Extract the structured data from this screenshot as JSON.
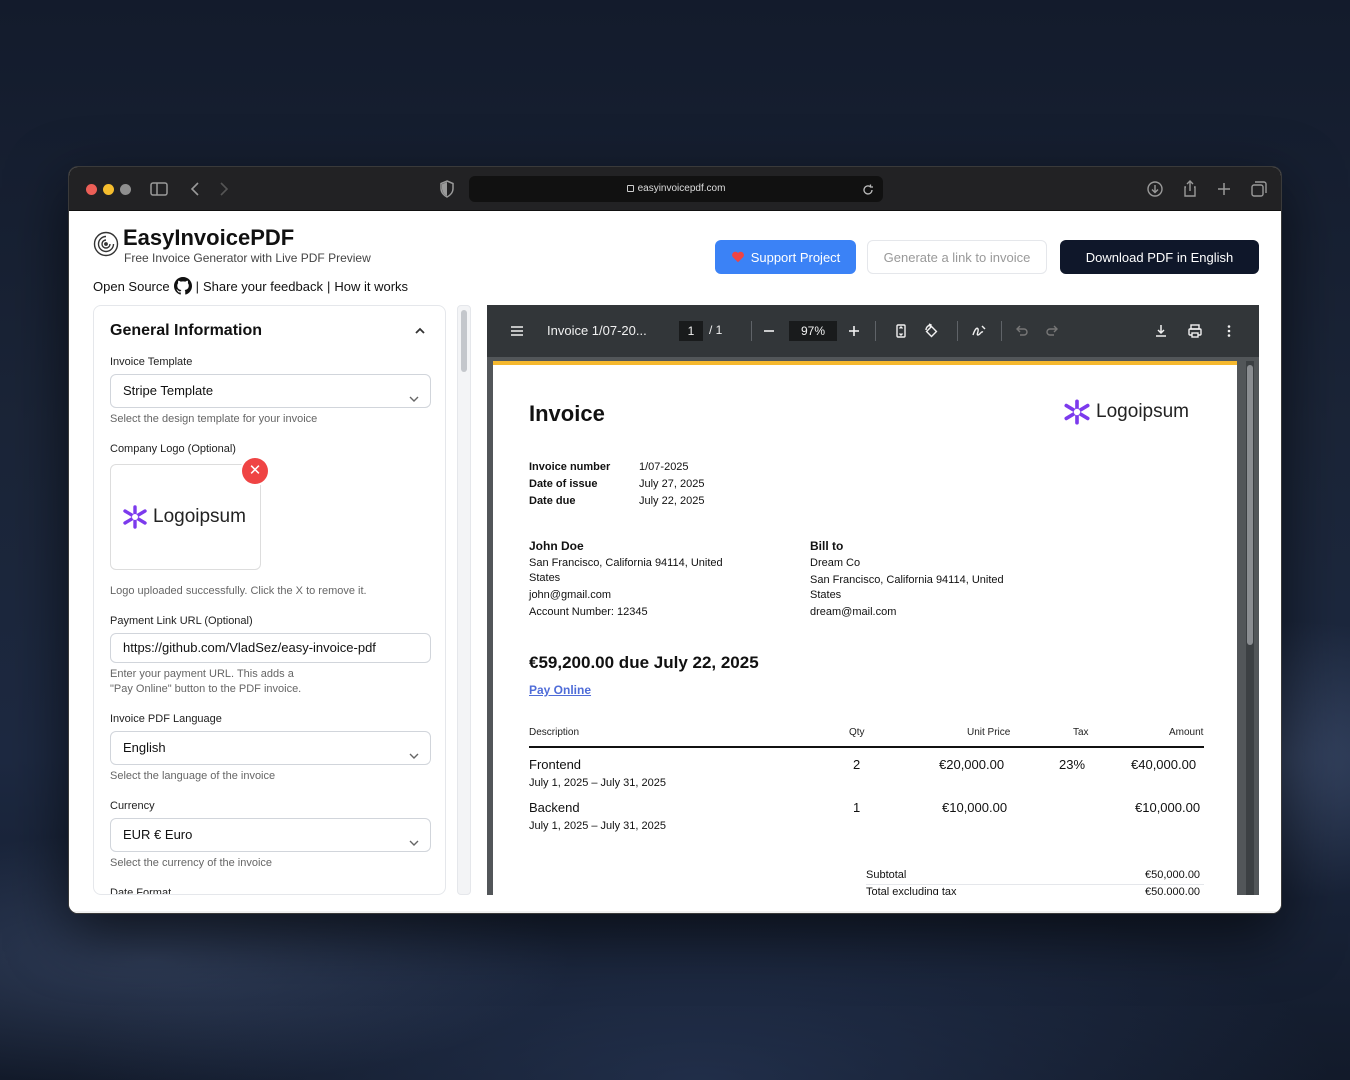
{
  "browser": {
    "url": "easyinvoicepdf.com",
    "traffic_lights": [
      "#ec5f57",
      "#f5bd2e",
      "#8f8f8f"
    ]
  },
  "app": {
    "title": "EasyInvoicePDF",
    "tagline": "Free Invoice Generator with Live PDF Preview",
    "links": {
      "open_source": "Open Source",
      "sep1": "|",
      "feedback": "Share your feedback",
      "sep2": "|",
      "how": "How it works"
    },
    "buttons": {
      "support": "Support Project",
      "support_icon": "heart-icon",
      "generate_link": "Generate a link to invoice",
      "download": "Download PDF in English"
    }
  },
  "form": {
    "section_title": "General Information",
    "template_label": "Invoice Template",
    "template_value": "Stripe Template",
    "template_hint": "Select the design template for your invoice",
    "logo_label": "Company Logo (Optional)",
    "logo_text": "Logoipsum",
    "logo_hint": "Logo uploaded successfully. Click the X to remove it.",
    "payment_label": "Payment Link URL (Optional)",
    "payment_value": "https://github.com/VladSez/easy-invoice-pdf",
    "payment_hint_1": "Enter your payment URL. This adds a",
    "payment_hint_2": "\"Pay Online\" button to the PDF invoice.",
    "language_label": "Invoice PDF Language",
    "language_value": "English",
    "language_hint": "Select the language of the invoice",
    "currency_label": "Currency",
    "currency_value": "EUR € Euro",
    "currency_hint": "Select the currency of the invoice",
    "next_label_partial": "Date Format"
  },
  "viewer": {
    "doc_title": "Invoice 1/07-20...",
    "page_current": "1",
    "page_total": "/   1",
    "zoom": "97%"
  },
  "invoice": {
    "heading": "Invoice",
    "logo_text": "Logoipsum",
    "meta": [
      {
        "label": "Invoice number",
        "value": "1/07-2025"
      },
      {
        "label": "Date of issue",
        "value": "July 27, 2025"
      },
      {
        "label": "Date due",
        "value": "July 22, 2025"
      }
    ],
    "seller": {
      "name": "John Doe",
      "address_1": "San Francisco, California 94114, United",
      "address_2": "States",
      "email": "john@gmail.com",
      "account": "Account Number: 12345"
    },
    "buyer": {
      "heading": "Bill to",
      "name": "Dream Co",
      "address_1": "San Francisco, California 94114, United",
      "address_2": "States",
      "email": "dream@mail.com"
    },
    "amount_due": "€59,200.00 due July 22, 2025",
    "pay_online": "Pay Online",
    "table_headers": {
      "description": "Description",
      "qty": "Qty",
      "unit_price": "Unit Price",
      "tax": "Tax",
      "amount": "Amount"
    },
    "items": [
      {
        "name": "Frontend",
        "period": "July 1, 2025 – July 31, 2025",
        "qty": "2",
        "unit_price": "€20,000.00",
        "tax": "23%",
        "amount": "€40,000.00"
      },
      {
        "name": "Backend",
        "period": "July 1, 2025 – July 31, 2025",
        "qty": "1",
        "unit_price": "€10,000.00",
        "tax": "",
        "amount": "€10,000.00"
      }
    ],
    "subtotal_label": "Subtotal",
    "subtotal_value": "€50,000.00",
    "excl_tax_label": "Total excluding tax",
    "excl_tax_value": "€50,000.00"
  }
}
